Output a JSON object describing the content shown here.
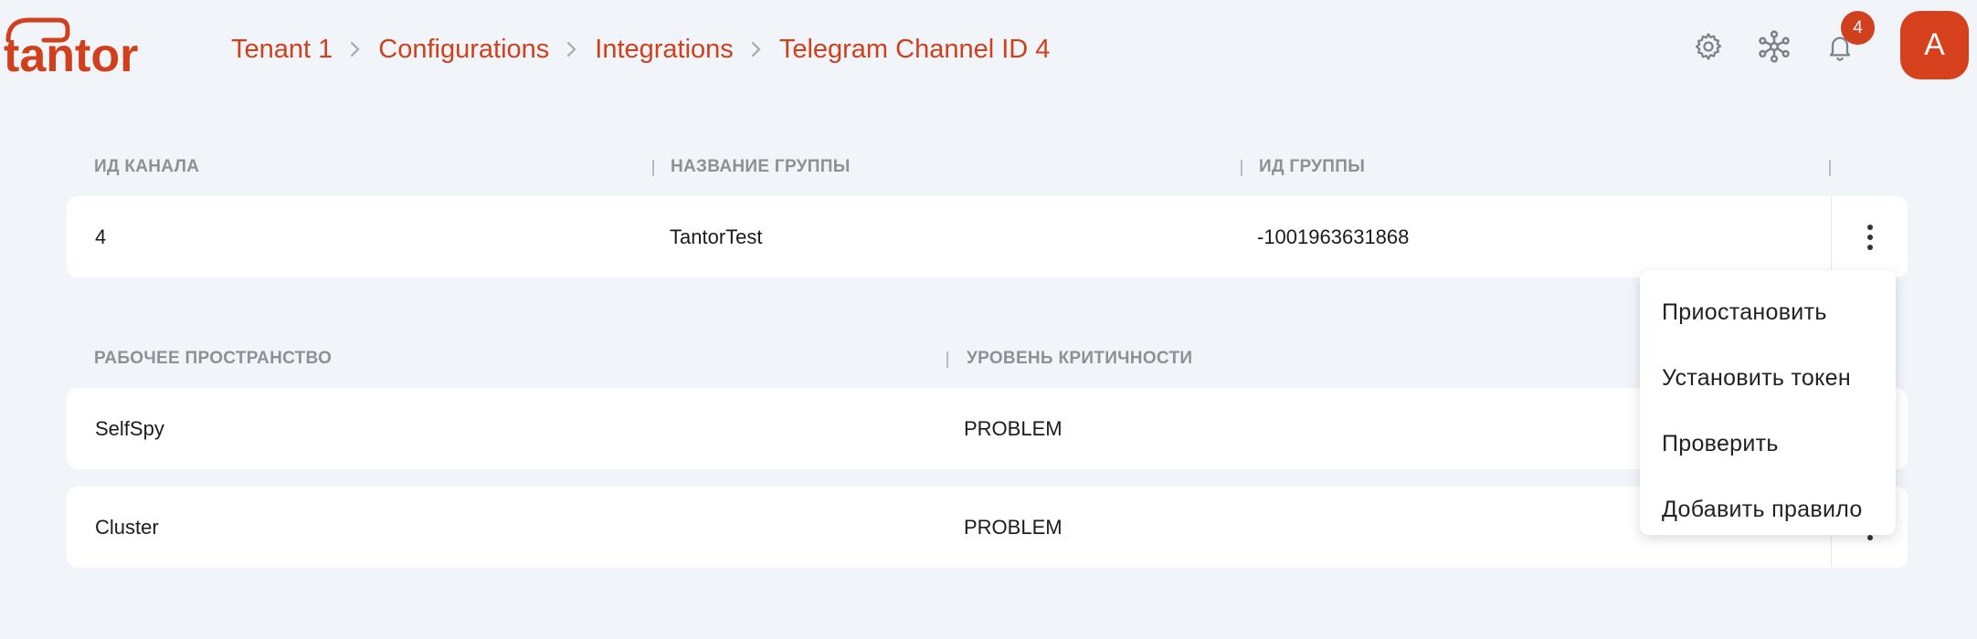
{
  "logo": {
    "text": "tantor"
  },
  "breadcrumb": {
    "items": [
      "Tenant 1",
      "Configurations",
      "Integrations",
      "Telegram Channel ID 4"
    ]
  },
  "header": {
    "notifications_count": "4",
    "avatar_initial": "A",
    "icons": [
      "gear-icon",
      "network-icon",
      "bell-icon"
    ]
  },
  "channel_table": {
    "columns": [
      "ИД КАНАЛА",
      "НАЗВАНИЕ ГРУППЫ",
      "ИД ГРУППЫ"
    ],
    "row": {
      "channel_id": "4",
      "group_name": "TantorTest",
      "group_id": "-1001963631868"
    }
  },
  "rules_table": {
    "columns": [
      "РАБОЧЕЕ ПРОСТРАНСТВО",
      "УРОВЕНЬ КРИТИЧНОСТИ"
    ],
    "rows": [
      {
        "workspace": "SelfSpy",
        "severity": "PROBLEM"
      },
      {
        "workspace": "Cluster",
        "severity": "PROBLEM"
      }
    ]
  },
  "context_menu": {
    "items": [
      "Приостановить",
      "Установить токен",
      "Проверить",
      "Добавить правило"
    ]
  },
  "colors": {
    "accent": "#d0401c",
    "background": "#f1f4f9"
  }
}
